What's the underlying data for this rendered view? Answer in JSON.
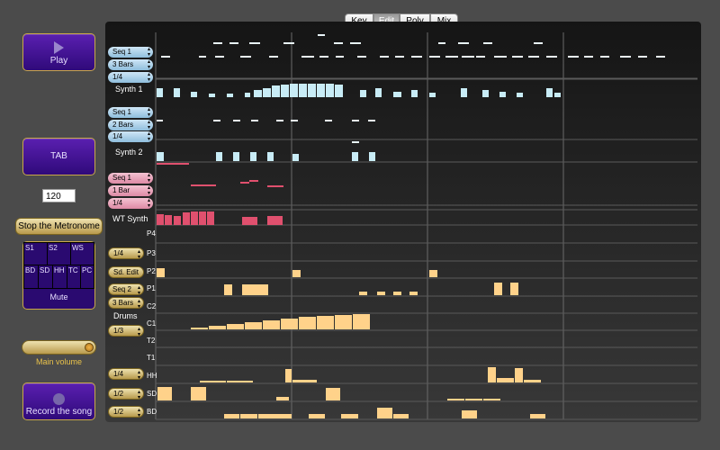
{
  "tabs": {
    "key": "Key",
    "edit": "Edit",
    "poly": "Poly",
    "mix": "Mix"
  },
  "left": {
    "play": "Play",
    "tab": "TAB",
    "tempo": "120",
    "metronome": "Stop the Metronome",
    "mute_labels": [
      "S1",
      "S2",
      "WS",
      "BD",
      "SD",
      "HH",
      "TC",
      "PC"
    ],
    "mute": "Mute",
    "volume_label": "Main volume",
    "volume_level": 0.96,
    "record": "Record the song"
  },
  "tracks": {
    "synth1": {
      "seq": "Seq 1",
      "bars": "3 Bars",
      "div": "1/4",
      "name": "Synth 1"
    },
    "synth2": {
      "seq": "Seq 1",
      "bars": "2 Bars",
      "div": "1/4",
      "name": "Synth 2"
    },
    "wt": {
      "seq": "Seq 1",
      "bars": "1 Bar",
      "div": "1/4",
      "name": "WT Synth"
    }
  },
  "drums": {
    "name": "Drums",
    "rows": [
      "P4",
      "P3",
      "P2",
      "P1",
      "C2",
      "C1",
      "T2",
      "T1",
      "HH",
      "SD",
      "BD"
    ],
    "p3_div": "1/4",
    "sd_edit": "Sd. Edit",
    "seq": "Seq 2",
    "bars": "3 Bars",
    "c1_div": "1/3",
    "hh_div": "1/4",
    "sd_div": "1/2",
    "bd_div": "1/2"
  },
  "colors": {
    "synth": "#c8ecf6",
    "wt": "#e0506e",
    "drum": "#ffd28a",
    "panel_border": "#c9a84a"
  }
}
